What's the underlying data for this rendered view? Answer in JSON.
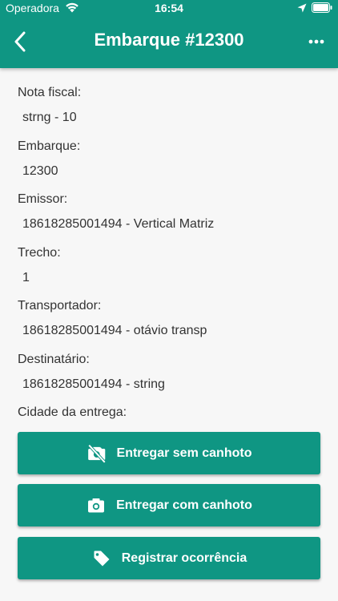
{
  "status_bar": {
    "carrier": "Operadora",
    "time": "16:54"
  },
  "header": {
    "title": "Embarque #12300",
    "back_icon": "back-arrow-icon",
    "more_icon": "more-horizontal-icon"
  },
  "fields": [
    {
      "label": "Nota fiscal:",
      "value": "strng - 10"
    },
    {
      "label": "Embarque:",
      "value": "12300"
    },
    {
      "label": "Emissor:",
      "value": "18618285001494 - Vertical Matriz"
    },
    {
      "label": "Trecho:",
      "value": "1"
    },
    {
      "label": "Transportador:",
      "value": "18618285001494 - otávio transp"
    },
    {
      "label": "Destinatário:",
      "value": "18618285001494 - string"
    },
    {
      "label": "Cidade da entrega:",
      "value": ""
    }
  ],
  "actions": [
    {
      "label": "Entregar sem canhoto",
      "icon": "no-camera-icon"
    },
    {
      "label": "Entregar com canhoto",
      "icon": "camera-icon"
    },
    {
      "label": "Registrar ocorrência",
      "icon": "tag-icon"
    }
  ],
  "colors": {
    "primary": "#0f9683",
    "background": "#f7f7f7",
    "text": "#333333"
  }
}
